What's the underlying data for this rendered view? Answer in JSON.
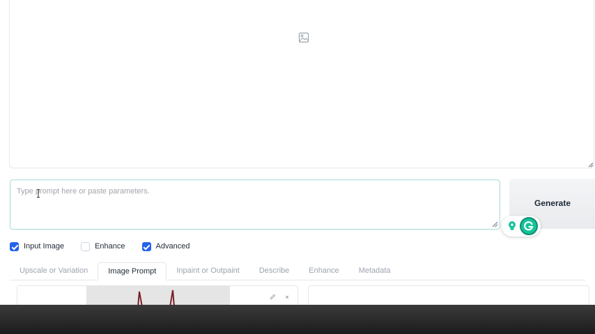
{
  "gallery": {
    "icon": "image-icon"
  },
  "prompt": {
    "placeholder": "Type prompt here or paste parameters.",
    "value": ""
  },
  "generate": {
    "label": "Generate"
  },
  "grammarly": {
    "icons": [
      "bulb-icon",
      "grammarly-icon"
    ],
    "accent": "#15c39a"
  },
  "options": [
    {
      "label": "Input Image",
      "checked": true
    },
    {
      "label": "Enhance",
      "checked": false
    },
    {
      "label": "Advanced",
      "checked": true
    }
  ],
  "tabs": [
    {
      "label": "Upscale or Variation",
      "active": false
    },
    {
      "label": "Image Prompt",
      "active": true
    },
    {
      "label": "Inpaint or Outpaint",
      "active": false
    },
    {
      "label": "Describe",
      "active": false
    },
    {
      "label": "Enhance",
      "active": false
    },
    {
      "label": "Metadata",
      "active": false
    }
  ],
  "image_panel": {
    "edit_icon": "pencil-icon",
    "close_label": "×"
  },
  "colors": {
    "checkbox": "#2563eb",
    "prompt_border": "#a7d8d9"
  }
}
